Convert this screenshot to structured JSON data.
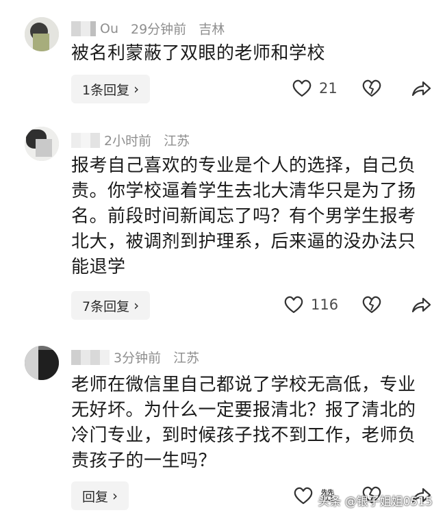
{
  "comments": [
    {
      "username": "Ou",
      "time": "29分钟前",
      "location": "吉林",
      "text": "被名利蒙蔽了双眼的老师和学校",
      "reply_label": "1条回复",
      "likes": "21"
    },
    {
      "username": "",
      "time": "2小时前",
      "location": "江苏",
      "text": "报考自己喜欢的专业是个人的选择，自己负责。你学校逼着学生去北大清华只是为了扬名。前段时间新闻忘了吗？有个男学生报考北大，被调剂到护理系，后来逼的没办法只能退学",
      "reply_label": "7条回复",
      "likes": "116"
    },
    {
      "username": "",
      "time": "3分钟前",
      "location": "江苏",
      "text": "老师在微信里自己都说了学校无高低，专业无好坏。为什么一定要报清北？报了清北的冷门专业，到时候孩子找不到工作，老师负责孩子的一生吗？",
      "reply_label": "回复",
      "likes": "赞"
    }
  ],
  "icons": {
    "like": "heart-outline-icon",
    "dislike": "broken-heart-icon",
    "share": "share-arrow-icon",
    "reply_chevron": "chevron-right-icon"
  },
  "watermark": "头条 @银子姐姐0515",
  "colors": {
    "meta": "#8e8e8e",
    "text": "#1a1a1a",
    "reply_bg": "#f3f3f3"
  }
}
